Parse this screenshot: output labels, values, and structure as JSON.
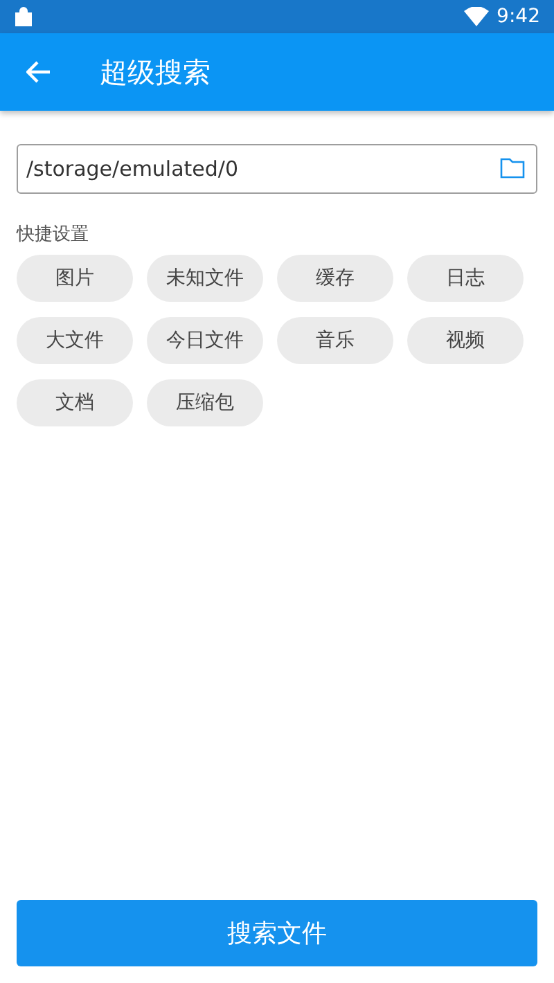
{
  "status_bar": {
    "time": "9:42"
  },
  "app_bar": {
    "title": "超级搜索"
  },
  "path_field": {
    "value": "/storage/emulated/0"
  },
  "quick_settings": {
    "label": "快捷设置",
    "chips": [
      "图片",
      "未知文件",
      "缓存",
      "日志",
      "大文件",
      "今日文件",
      "音乐",
      "视频",
      "文档",
      "压缩包"
    ]
  },
  "search_button": {
    "label": "搜索文件"
  }
}
